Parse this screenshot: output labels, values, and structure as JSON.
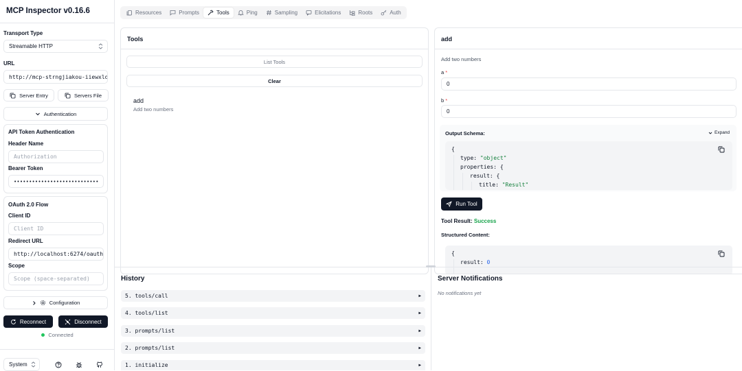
{
  "app": {
    "title": "MCP Inspector v0.16.6"
  },
  "sidebar": {
    "transport_label": "Transport Type",
    "transport_value": "Streamable HTTP",
    "url_label": "URL",
    "url_value": "http://mcp-strngjiakou-iiewxlde",
    "server_entry_label": "Server Entry",
    "servers_file_label": "Servers File",
    "authentication_label": "Authentication",
    "api_token_title": "API Token Authentication",
    "header_name_label": "Header Name",
    "header_name_placeholder": "Authorization",
    "bearer_token_label": "Bearer Token",
    "bearer_token_value": "••••••••••••••••••••••••••••",
    "oauth_title": "OAuth 2.0 Flow",
    "client_id_label": "Client ID",
    "client_id_placeholder": "Client ID",
    "redirect_url_label": "Redirect URL",
    "redirect_url_value": "http://localhost:6274/oauth/",
    "scope_label": "Scope",
    "scope_placeholder": "Scope (space-separated)",
    "configuration_label": "Configuration",
    "reconnect_label": "Reconnect",
    "disconnect_label": "Disconnect",
    "status_text": "Connected",
    "status_color": "#22c55e",
    "theme_value": "System"
  },
  "tabs": [
    {
      "label": "Resources",
      "icon": "files-icon",
      "active": false
    },
    {
      "label": "Prompts",
      "icon": "message-icon",
      "active": false
    },
    {
      "label": "Tools",
      "icon": "hammer-icon",
      "active": true
    },
    {
      "label": "Ping",
      "icon": "bell-icon",
      "active": false
    },
    {
      "label": "Sampling",
      "icon": "hash-icon",
      "active": false
    },
    {
      "label": "Elicitations",
      "icon": "message-square-icon",
      "active": false
    },
    {
      "label": "Roots",
      "icon": "folder-tree-icon",
      "active": false
    },
    {
      "label": "Auth",
      "icon": "key-icon",
      "active": false
    }
  ],
  "tools_panel": {
    "title": "Tools",
    "list_tools_label": "List Tools",
    "clear_label": "Clear",
    "tools": [
      {
        "name": "add",
        "description": "Add two numbers"
      }
    ]
  },
  "tool_detail": {
    "title": "add",
    "description": "Add two numbers",
    "param_a_label": "a",
    "param_a_value": "0",
    "param_b_label": "b",
    "param_b_value": "0",
    "required_marker": "*",
    "output_schema_label": "Output Schema:",
    "expand_label": "Expand",
    "schema_lines": {
      "l1": "{",
      "l2_key": "type:",
      "l2_val": "\"object\"",
      "l3_key": "properties:",
      "l3_punct": "{",
      "l4_key": "result:",
      "l4_punct": "{",
      "l5_key": "title:",
      "l5_val": "\"Result\""
    },
    "run_tool_label": "Run Tool",
    "tool_result_label": "Tool Result:",
    "tool_result_status": "Success",
    "structured_content_label": "Structured Content:",
    "result_lines": {
      "l1": "{",
      "l2_key": "result:",
      "l2_val": "0"
    }
  },
  "history": {
    "title": "History",
    "items": [
      {
        "label": "5. tools/call"
      },
      {
        "label": "4. tools/list"
      },
      {
        "label": "3. prompts/list"
      },
      {
        "label": "2. prompts/list"
      },
      {
        "label": "1. initialize"
      }
    ],
    "expand_glyph": "▶"
  },
  "notifications": {
    "title": "Server Notifications",
    "empty_text": "No notifications yet"
  }
}
